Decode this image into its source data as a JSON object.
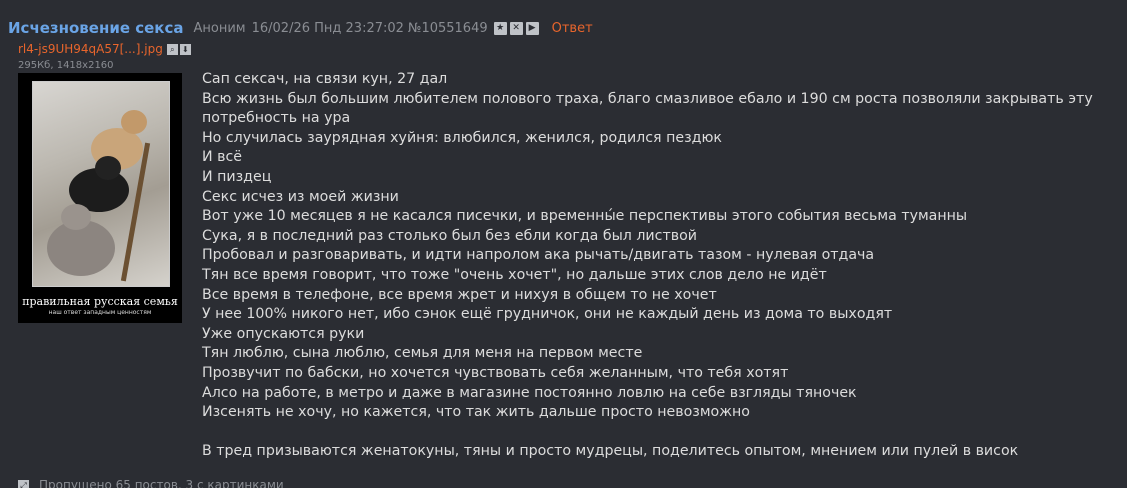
{
  "post": {
    "subject": "Исчезновение секса",
    "author": "Аноним",
    "date": "16/02/26 Пнд 23:27:02",
    "number": "№10551649",
    "reply_label": "Ответ",
    "icons": [
      "star-icon",
      "hide-icon",
      "play-icon"
    ]
  },
  "file": {
    "name": "rl4-js9UH94qA57[...].jpg",
    "meta": "295Кб, 1418x2160",
    "icons": [
      "search-icon",
      "download-icon"
    ],
    "caption": "правильная русская семья",
    "subcaption": "наш ответ западным ценностям"
  },
  "message": {
    "lines": [
      "Сап сексач, на связи кун, 27 дал",
      "Всю жизнь был большим любителем полового траха, благо смазливое ебало и 190 см роста позволяли закрывать эту потребность на ура",
      "Но случилась заурядная хуйня: влюбился, женился, родился пездюк",
      "И всё",
      "И пиздец",
      "Секс исчез из моей жизни",
      "Вот уже 10 месяцев я не касался писечки, и временны́е перспективы этого события весьма туманны",
      "Сука, я в последний раз столько был без ебли когда был листвой",
      "Пробовал и разговаривать, и идти напролом ака рычать/двигать тазом - нулевая отдача",
      "Тян все время говорит, что тоже \"очень хочет\", но дальше этих слов дело не идёт",
      "Все время в телефоне, все время жрет и нихуя в общем то не хочет",
      "У нее 100% никого нет, ибо сэнок ещё грудничок, они не каждый день из дома то выходят",
      "Уже опускаются руки",
      "Тян люблю, сына люблю, семья для меня на первом месте",
      "Прозвучит по бабски, но хочется чувствовать себя желанным, что тебя хотят",
      "Алсо на работе, в метро и даже в магазине постоянно ловлю на себе взгляды тяночек",
      "Изсенять не хочу, но кажется, что так жить дальше просто невозможно",
      "",
      "В тред призываются женатокуны, тяны и просто мудрецы, поделитесь опытом, мнением или пулей в висок"
    ]
  },
  "omitted": {
    "text": "Пропущено 65 постов, 3 с картинками",
    "icon": "expand-icon"
  },
  "colors": {
    "background": "#2b2d33",
    "subject": "#6aa4e6",
    "link": "#e8652c",
    "text": "#dcdcdc",
    "meta": "#8a8d93"
  }
}
